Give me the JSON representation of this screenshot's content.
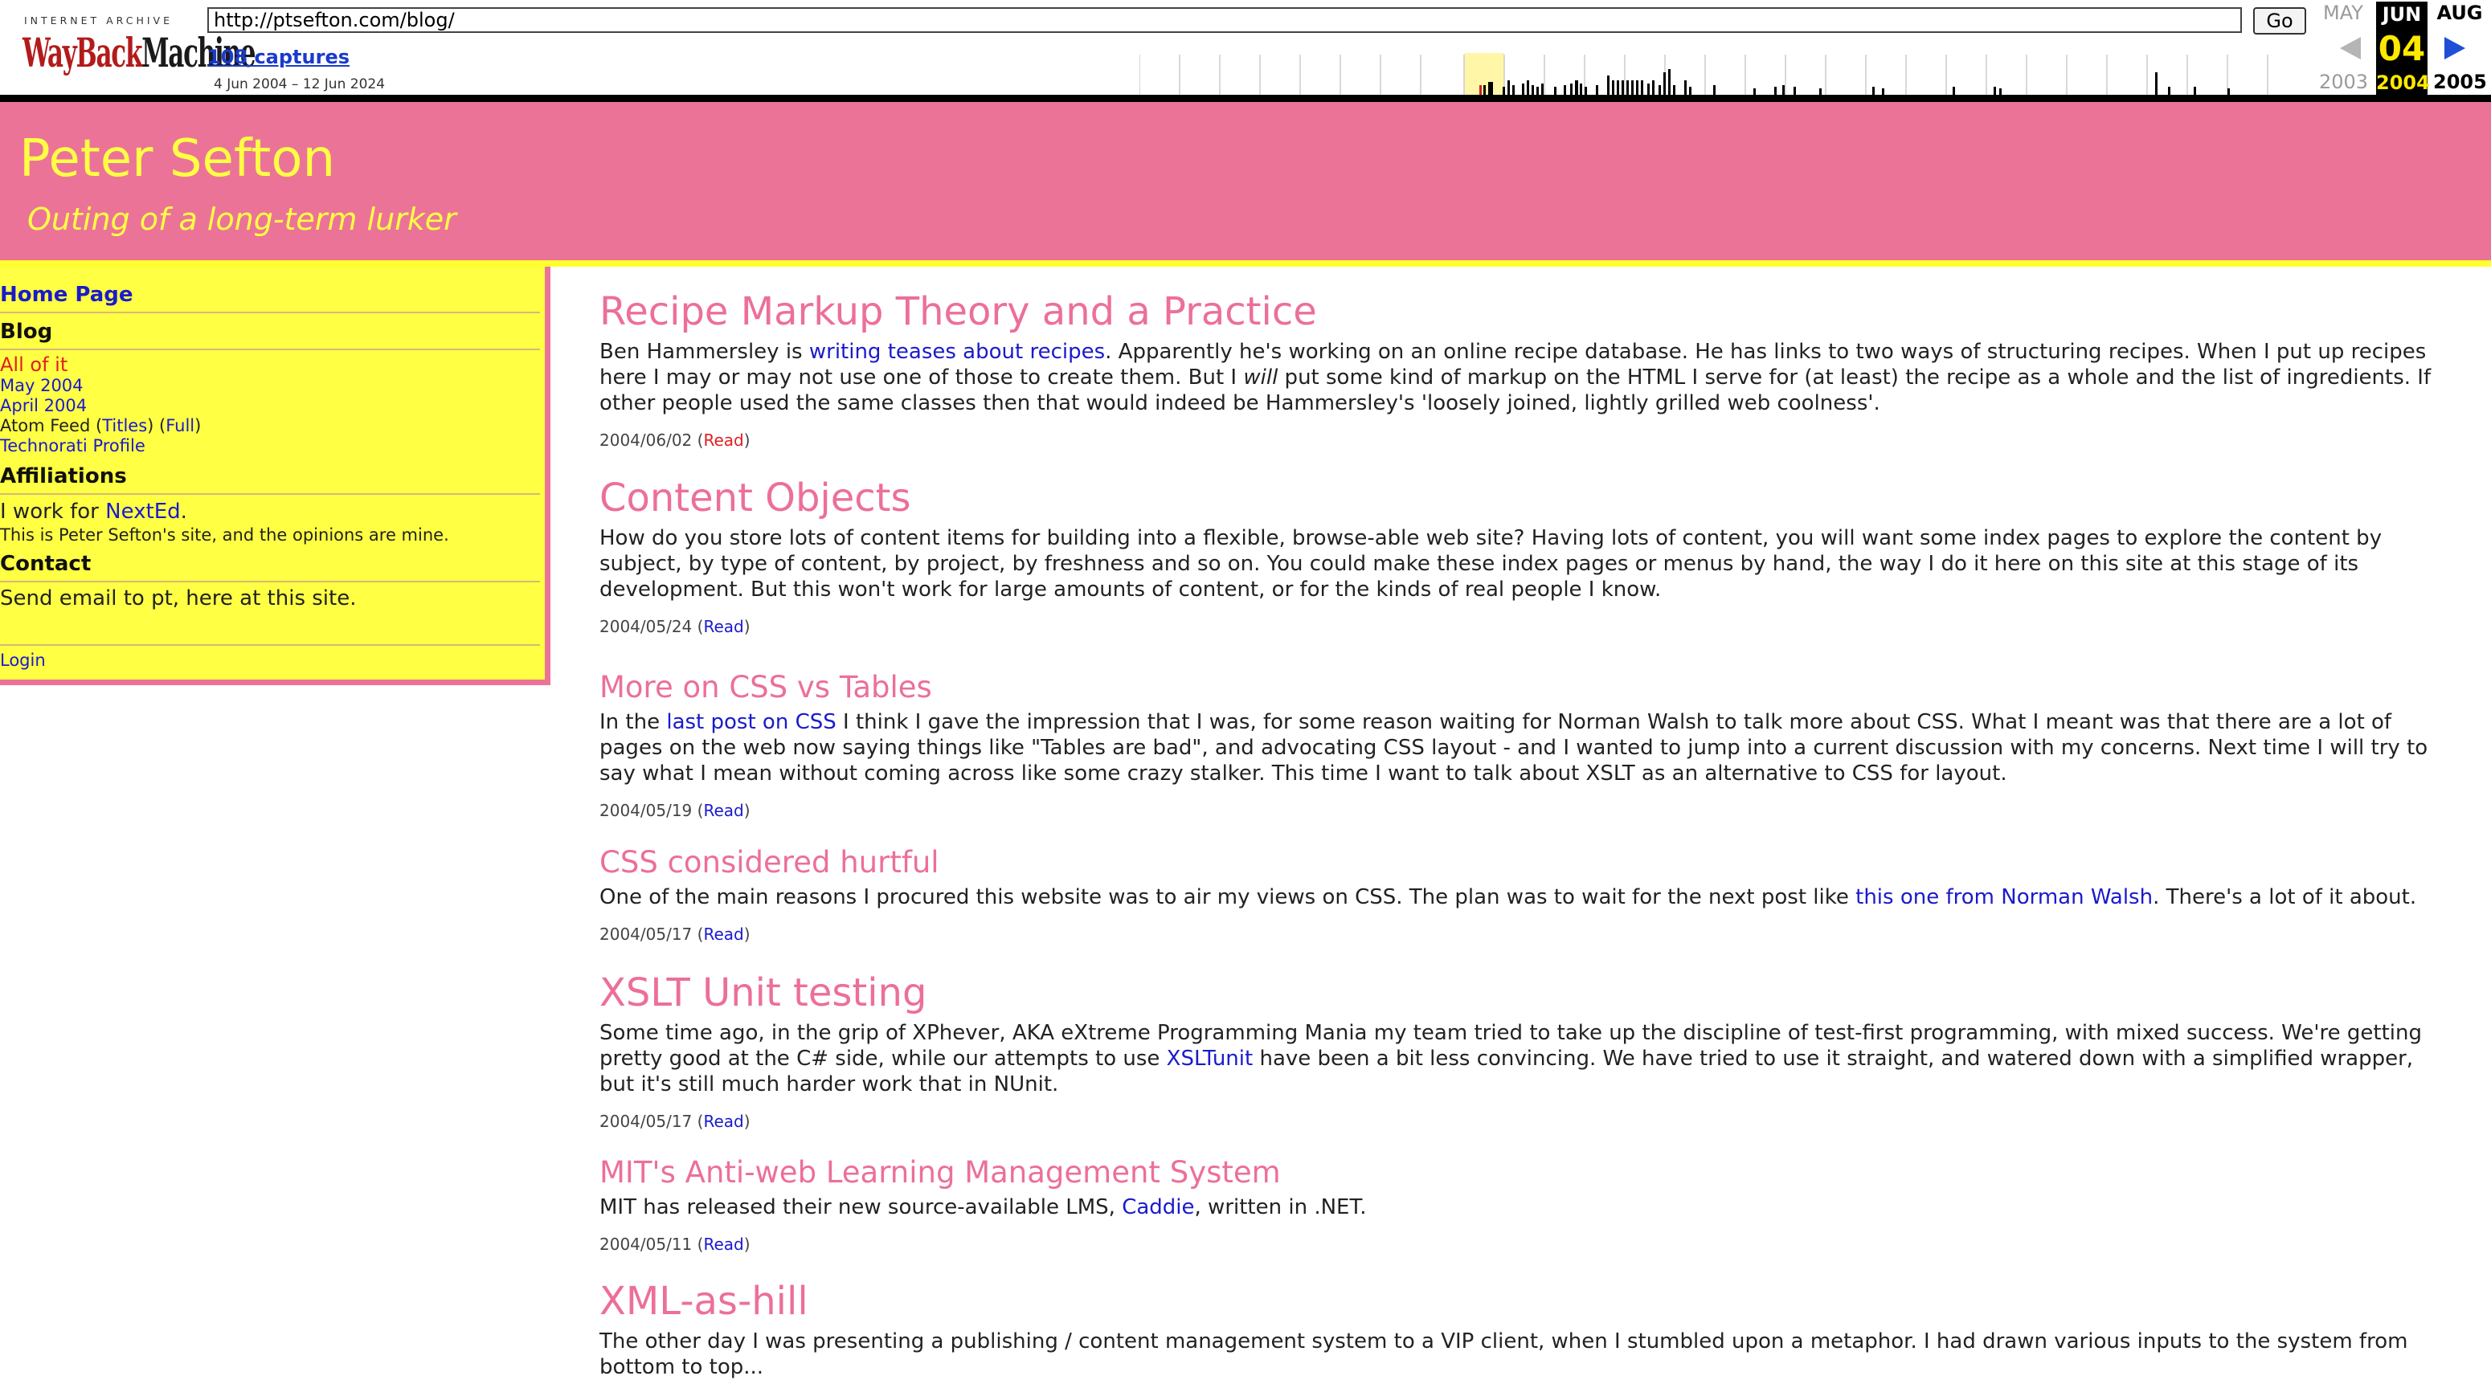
{
  "wayback": {
    "logo_top": "INTERNET ARCHIVE",
    "logo_wb": "WayBack",
    "logo_mc": "Machine",
    "url": "http://ptsefton.com/blog/",
    "go_label": "Go",
    "captures_label": "108 captures",
    "range_label": "4 Jun 2004 – 12 Jun 2024",
    "prev_month": "MAY",
    "cur_month": "JUN",
    "next_month": "AUG",
    "cur_day": "04",
    "prev_year": "2003",
    "cur_year": "2004",
    "next_year": "2005",
    "colors": {
      "accent_yellow": "#ffe900",
      "logo_red": "#b31b1b",
      "link_blue": "#1a3bcc"
    }
  },
  "site": {
    "title": "Peter Sefton",
    "tagline": "Outing of a long-term lurker",
    "colors": {
      "header_pink": "#ec7398",
      "title_yellow": "#ffff44",
      "post_title_pink": "#ec6f9a"
    }
  },
  "sidebar": {
    "home": "Home Page",
    "blog_heading": "Blog",
    "all_of_it": "All of it",
    "may_2004": "May 2004",
    "april_2004": "April 2004",
    "atom_feed_prefix": "Atom Feed (",
    "atom_titles": "Titles",
    "atom_sep": ") (",
    "atom_full": "Full",
    "atom_suffix": ")",
    "technorati": "Technorati Profile",
    "affiliations_heading": "Affiliations",
    "work_prefix": "I work for ",
    "work_link": "NextEd",
    "work_suffix": ".",
    "disclaimer": "This is Peter Sefton's site, and the opinions are mine.",
    "contact_heading": "Contact",
    "contact_text": "Send email to pt, here at this site.",
    "login": "Login"
  },
  "posts": [
    {
      "title": "Recipe Markup Theory and a Practice",
      "body_1": "Ben Hammersley is ",
      "link_1": "writing teases about recipes",
      "body_2": ". Apparently he's working on an online recipe database. He has links to two ways of structuring recipes. When I put up recipes here I may or may not use one of those to create them. But I ",
      "em": "will",
      "body_3": " put some kind of markup on the HTML I serve for (at least) the recipe as a whole and the list of ingredients. If other people used the same classes then that would indeed be Hammersley's 'loosely joined, lightly grilled web coolness'.",
      "date": "2004/06/02",
      "read": "Read"
    },
    {
      "title": "Content Objects",
      "body_1": "How do you store lots of content items for building into a flexible, browse-able web site? Having lots of content, you will want some index pages to explore the content by subject, by type of content, by project, by freshness and so on. You could make these index pages or menus by hand, the way I do it here on this site at this stage of its development. But this won't work for large amounts of content, or for the kinds of real people I know.",
      "date": "2004/05/24",
      "read": "Read"
    },
    {
      "title": "More on CSS vs Tables",
      "body_1": "In the ",
      "link_1": "last post on CSS",
      "body_2": " I think I gave the impression that I was, for some reason waiting for Norman Walsh to talk more about CSS. What I meant was that there are a lot of pages on the web now saying things like \"Tables are bad\", and advocating CSS layout - and I wanted to jump into a current discussion with my concerns. Next time I will try to say what I mean without coming across like some crazy stalker. This time I want to talk about XSLT as an alternative to CSS for layout.",
      "date": "2004/05/19",
      "read": "Read"
    },
    {
      "title": "CSS considered hurtful",
      "body_1": "One of the main reasons I procured this website was to air my views on CSS. The plan was to wait for the next post like ",
      "link_1": "this one from Norman Walsh",
      "body_2": ". There's a lot of it about.",
      "date": "2004/05/17",
      "read": "Read"
    },
    {
      "title": "XSLT Unit testing",
      "body_1": "Some time ago, in the grip of XPhever, AKA eXtreme Programming Mania my team tried to take up the discipline of test-first programming, with mixed success. We're getting pretty good at the C# side, while our attempts to use ",
      "link_1": "XSLTunit",
      "body_2": " have been a bit less convincing. We have tried to use it straight, and watered down with a simplified wrapper, but it's still much harder work that in NUnit.",
      "date": "2004/05/17",
      "read": "Read"
    },
    {
      "title": "MIT's Anti-web Learning Management System",
      "body_1": "MIT has released their new source-available LMS, ",
      "link_1": "Caddie",
      "body_2": ", written in .NET.",
      "date": "2004/05/11",
      "read": "Read"
    },
    {
      "title": "XML-as-hill",
      "body_1": "The other day I was presenting a publishing / content management system to a VIP client, when I stumbled upon a metaphor. I had drawn various inputs to the system from bottom to top..."
    }
  ]
}
